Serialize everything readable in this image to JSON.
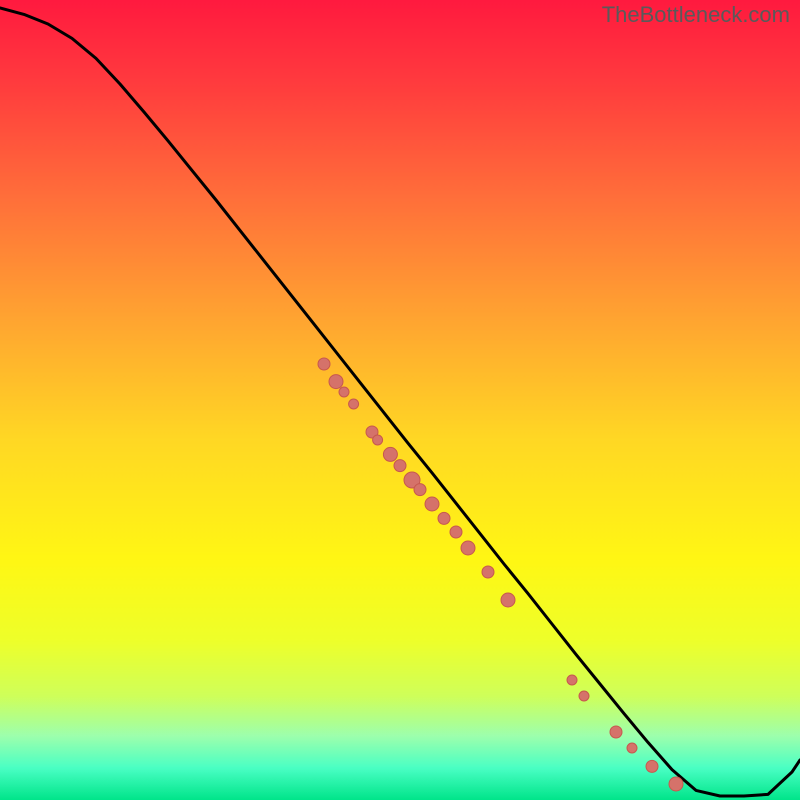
{
  "watermark": "TheBottleneck.com",
  "chart_data": {
    "type": "line",
    "title": "",
    "xlabel": "",
    "ylabel": "",
    "xlim": [
      0,
      100
    ],
    "ylim": [
      0,
      100
    ],
    "grid": false,
    "legend": false,
    "background": "rainbow-vertical",
    "series": [
      {
        "name": "bottleneck-curve",
        "color": "#000000",
        "x": [
          0,
          3,
          6,
          9,
          12,
          15,
          18,
          21,
          24,
          27,
          30,
          33,
          36,
          39,
          42,
          45,
          48,
          51,
          54,
          57,
          60,
          63,
          66,
          69,
          72,
          75,
          78,
          81,
          84,
          87,
          90,
          93,
          96,
          99,
          100
        ],
        "y": [
          99,
          98.2,
          97,
          95.2,
          92.7,
          89.5,
          86,
          82.4,
          78.7,
          75,
          71.2,
          67.4,
          63.6,
          59.8,
          56,
          52.2,
          48.4,
          44.6,
          40.9,
          37.1,
          33.3,
          29.5,
          25.8,
          22.0,
          18.2,
          14.5,
          10.8,
          7.2,
          3.8,
          1.2,
          0.5,
          0.5,
          0.7,
          3.5,
          5.0
        ]
      }
    ],
    "scatter_points": {
      "name": "data-points",
      "color_fill": "#d5726a",
      "color_stroke": "#c7584e",
      "points": [
        {
          "x": 40.5,
          "y": 54.5,
          "r": 6
        },
        {
          "x": 42.0,
          "y": 52.3,
          "r": 7
        },
        {
          "x": 43.0,
          "y": 51.0,
          "r": 5
        },
        {
          "x": 44.2,
          "y": 49.5,
          "r": 5
        },
        {
          "x": 46.5,
          "y": 46.0,
          "r": 6
        },
        {
          "x": 47.2,
          "y": 45.0,
          "r": 5
        },
        {
          "x": 48.8,
          "y": 43.2,
          "r": 7
        },
        {
          "x": 50.0,
          "y": 41.8,
          "r": 6
        },
        {
          "x": 51.5,
          "y": 40.0,
          "r": 8
        },
        {
          "x": 52.5,
          "y": 38.8,
          "r": 6
        },
        {
          "x": 54.0,
          "y": 37.0,
          "r": 7
        },
        {
          "x": 55.5,
          "y": 35.2,
          "r": 6
        },
        {
          "x": 57.0,
          "y": 33.5,
          "r": 6
        },
        {
          "x": 58.5,
          "y": 31.5,
          "r": 7
        },
        {
          "x": 61.0,
          "y": 28.5,
          "r": 6
        },
        {
          "x": 63.5,
          "y": 25.0,
          "r": 7
        },
        {
          "x": 71.5,
          "y": 15.0,
          "r": 5
        },
        {
          "x": 73.0,
          "y": 13.0,
          "r": 5
        },
        {
          "x": 77.0,
          "y": 8.5,
          "r": 6
        },
        {
          "x": 79.0,
          "y": 6.5,
          "r": 5
        },
        {
          "x": 81.5,
          "y": 4.2,
          "r": 6
        },
        {
          "x": 84.5,
          "y": 2.0,
          "r": 7
        }
      ]
    },
    "gradient_stops": [
      {
        "pos": 0.0,
        "color": "#ff1a3f"
      },
      {
        "pos": 0.1,
        "color": "#ff3a3e"
      },
      {
        "pos": 0.25,
        "color": "#ff703a"
      },
      {
        "pos": 0.4,
        "color": "#ffa531"
      },
      {
        "pos": 0.55,
        "color": "#ffd824"
      },
      {
        "pos": 0.7,
        "color": "#fff714"
      },
      {
        "pos": 0.8,
        "color": "#eeff2a"
      },
      {
        "pos": 0.87,
        "color": "#cfff5a"
      },
      {
        "pos": 0.92,
        "color": "#9dffad"
      },
      {
        "pos": 0.96,
        "color": "#4affc4"
      },
      {
        "pos": 1.0,
        "color": "#00e58a"
      }
    ]
  }
}
